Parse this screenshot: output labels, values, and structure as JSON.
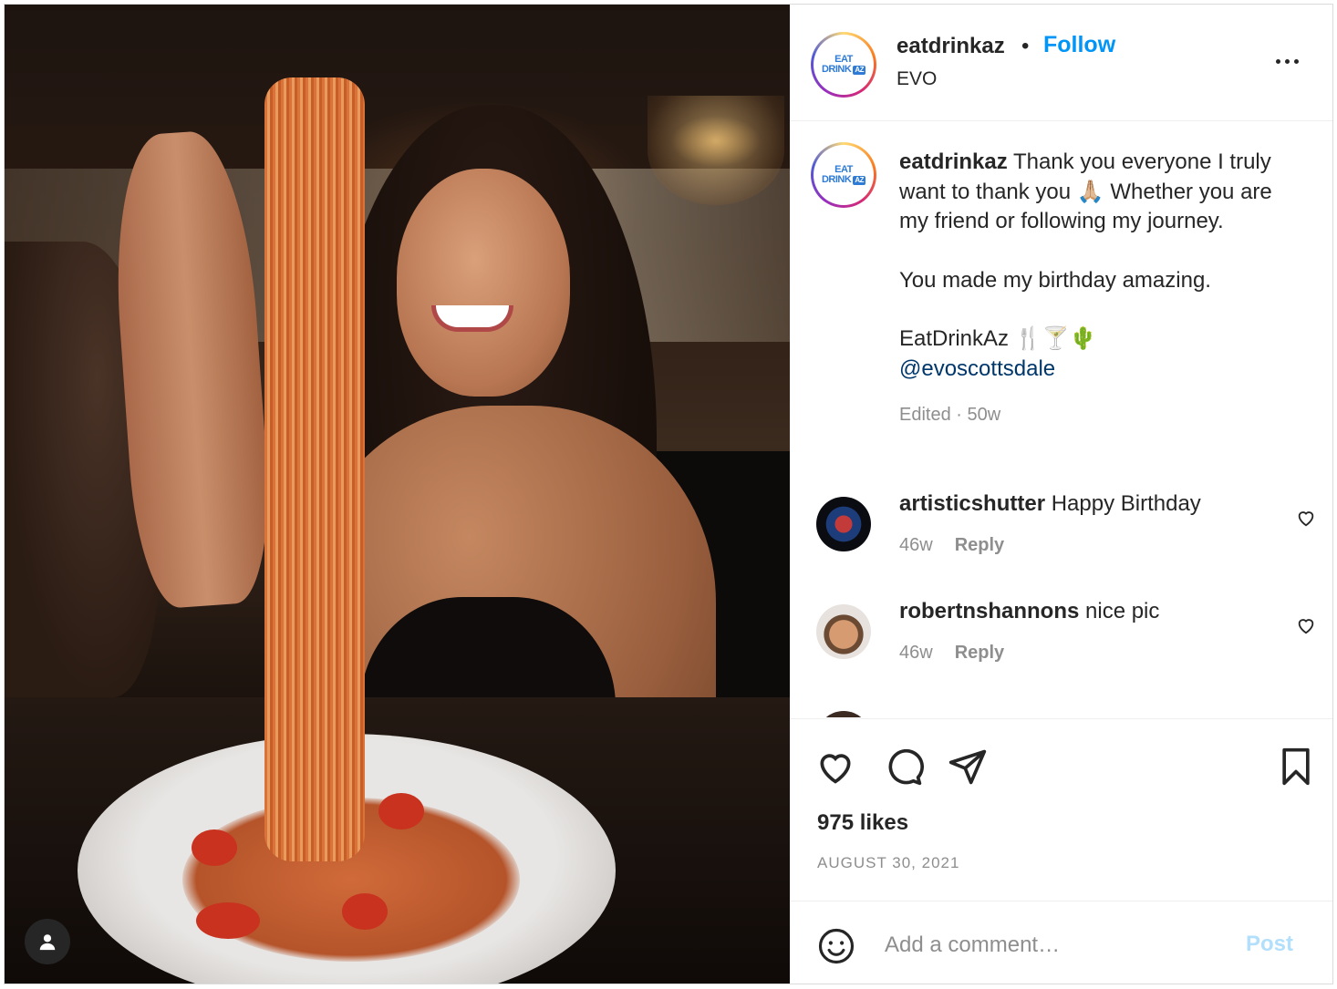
{
  "header": {
    "username": "eatdrinkaz",
    "separator": "•",
    "follow_label": "Follow",
    "location": "EVO",
    "more_icon": "more-horizontal-icon"
  },
  "avatar_logo": {
    "line1": "EAT",
    "line2": "DRINK",
    "badge": "AZ"
  },
  "caption": {
    "username": "eatdrinkaz",
    "text1": " Thank you everyone I truly want to thank you 🙏🏼 Whether you are my friend or following my journey.",
    "text2": "You made my birthday amazing.",
    "text3": "EatDrinkAz 🍴🍸🌵",
    "mention": "@evoscottsdale",
    "meta": "Edited · 50w"
  },
  "comments": [
    {
      "username": "artisticshutter",
      "text": " Happy Birthday",
      "age": "46w",
      "reply_label": "Reply"
    },
    {
      "username": "robertnshannons",
      "text": " nice pic",
      "age": "46w",
      "reply_label": "Reply"
    }
  ],
  "actions": {
    "likes": "975 likes",
    "date": "AUGUST 30, 2021"
  },
  "composer": {
    "placeholder": "Add a comment…",
    "post_label": "Post"
  },
  "colors": {
    "accent": "#0095f6",
    "link": "#00376b",
    "muted": "#8e8e8e",
    "post_disabled": "#b2dffc"
  }
}
